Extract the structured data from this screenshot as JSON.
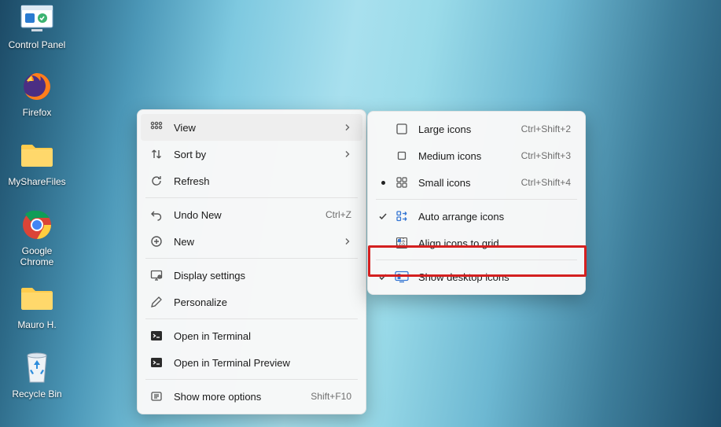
{
  "desktop_icons": [
    {
      "key": "control-panel",
      "label": "Control Panel"
    },
    {
      "key": "firefox",
      "label": "Firefox"
    },
    {
      "key": "mysharefiles",
      "label": "MyShareFiles"
    },
    {
      "key": "google-chrome",
      "label": "Google\nChrome"
    },
    {
      "key": "mauro-h",
      "label": "Mauro H."
    },
    {
      "key": "recycle-bin",
      "label": "Recycle Bin"
    }
  ],
  "context_menu": {
    "items": [
      {
        "label": "View",
        "icon": "grid-icon",
        "submenu": true,
        "hovered": true
      },
      {
        "label": "Sort by",
        "icon": "sort-icon",
        "submenu": true
      },
      {
        "label": "Refresh",
        "icon": "refresh-icon"
      },
      "sep",
      {
        "label": "Undo New",
        "icon": "undo-icon",
        "hint": "Ctrl+Z"
      },
      {
        "label": "New",
        "icon": "new-icon",
        "submenu": true
      },
      "sep",
      {
        "label": "Display settings",
        "icon": "display-icon"
      },
      {
        "label": "Personalize",
        "icon": "personalize-icon"
      },
      "sep",
      {
        "label": "Open in Terminal",
        "icon": "terminal-icon"
      },
      {
        "label": "Open in Terminal Preview",
        "icon": "terminal-icon"
      },
      "sep",
      {
        "label": "Show more options",
        "icon": "more-icon",
        "hint": "Shift+F10"
      }
    ]
  },
  "view_submenu": {
    "items": [
      {
        "label": "Large icons",
        "icon": "large-icons-icon",
        "hint": "Ctrl+Shift+2"
      },
      {
        "label": "Medium icons",
        "icon": "medium-icons-icon",
        "hint": "Ctrl+Shift+3"
      },
      {
        "label": "Small icons",
        "icon": "small-icons-icon",
        "hint": "Ctrl+Shift+4",
        "radio": true
      },
      "sep",
      {
        "label": "Auto arrange icons",
        "icon": "auto-arrange-icon",
        "checked": true
      },
      {
        "label": "Align icons to grid",
        "icon": "align-grid-icon"
      },
      "sep",
      {
        "label": "Show desktop icons",
        "icon": "show-desktop-icon",
        "checked": true,
        "highlight": true
      }
    ]
  }
}
